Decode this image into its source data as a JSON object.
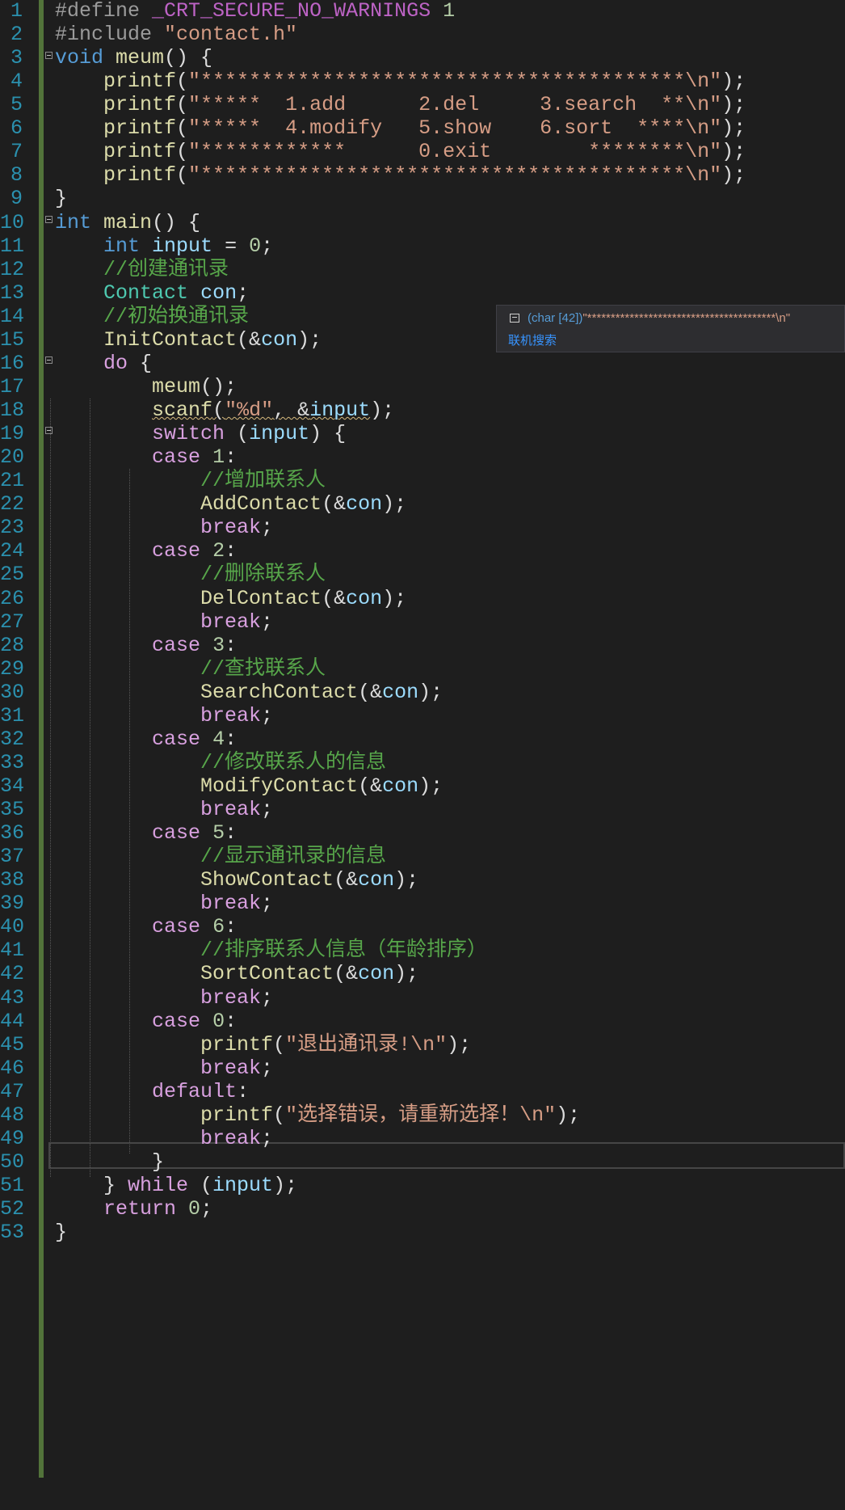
{
  "editor": {
    "line_numbers": [
      "1",
      "2",
      "3",
      "4",
      "5",
      "6",
      "7",
      "8",
      "9",
      "10",
      "11",
      "12",
      "13",
      "14",
      "15",
      "16",
      "17",
      "18",
      "19",
      "20",
      "21",
      "22",
      "23",
      "24",
      "25",
      "26",
      "27",
      "28",
      "29",
      "30",
      "31",
      "32",
      "33",
      "34",
      "35",
      "36",
      "37",
      "38",
      "39",
      "40",
      "41",
      "42",
      "43",
      "44",
      "45",
      "46",
      "47",
      "48",
      "49",
      "50",
      "51",
      "52",
      "53"
    ],
    "lines": [
      [
        {
          "c": "pp",
          "t": "#define "
        },
        {
          "c": "mac",
          "t": "_CRT_SECURE_NO_WARNINGS"
        },
        {
          "c": "pp",
          "t": " "
        },
        {
          "c": "num",
          "t": "1"
        }
      ],
      [
        {
          "c": "pp",
          "t": "#include "
        },
        {
          "c": "str",
          "t": "\"contact.h\""
        }
      ],
      [
        {
          "c": "kw",
          "t": "void"
        },
        {
          "c": "",
          "t": " "
        },
        {
          "c": "fn",
          "t": "meum"
        },
        {
          "c": "",
          "t": "() {"
        }
      ],
      [
        {
          "c": "",
          "t": "    "
        },
        {
          "c": "fn",
          "t": "printf"
        },
        {
          "c": "",
          "t": "("
        },
        {
          "c": "str",
          "t": "\"****************************************\\n\""
        },
        {
          "c": "",
          "t": ");"
        }
      ],
      [
        {
          "c": "",
          "t": "    "
        },
        {
          "c": "fn",
          "t": "printf"
        },
        {
          "c": "",
          "t": "("
        },
        {
          "c": "str",
          "t": "\"*****  1.add      2.del     3.search  **\\n\""
        },
        {
          "c": "",
          "t": ");"
        }
      ],
      [
        {
          "c": "",
          "t": "    "
        },
        {
          "c": "fn",
          "t": "printf"
        },
        {
          "c": "",
          "t": "("
        },
        {
          "c": "str",
          "t": "\"*****  4.modify   5.show    6.sort  ****\\n\""
        },
        {
          "c": "",
          "t": ");"
        }
      ],
      [
        {
          "c": "",
          "t": "    "
        },
        {
          "c": "fn",
          "t": "printf"
        },
        {
          "c": "",
          "t": "("
        },
        {
          "c": "str",
          "t": "\"************      0.exit        ********\\n\""
        },
        {
          "c": "",
          "t": ");"
        }
      ],
      [
        {
          "c": "",
          "t": "    "
        },
        {
          "c": "fn",
          "t": "printf"
        },
        {
          "c": "",
          "t": "("
        },
        {
          "c": "str",
          "t": "\"****************************************\\n\""
        },
        {
          "c": "",
          "t": ");"
        }
      ],
      [
        {
          "c": "",
          "t": "}"
        }
      ],
      [
        {
          "c": "kw",
          "t": "int"
        },
        {
          "c": "",
          "t": " "
        },
        {
          "c": "fn",
          "t": "main"
        },
        {
          "c": "",
          "t": "() {"
        }
      ],
      [
        {
          "c": "",
          "t": "    "
        },
        {
          "c": "kw",
          "t": "int"
        },
        {
          "c": "",
          "t": " "
        },
        {
          "c": "var",
          "t": "input"
        },
        {
          "c": "",
          "t": " = "
        },
        {
          "c": "num",
          "t": "0"
        },
        {
          "c": "",
          "t": ";"
        }
      ],
      [
        {
          "c": "",
          "t": "    "
        },
        {
          "c": "cm",
          "t": "//创建通讯录"
        }
      ],
      [
        {
          "c": "",
          "t": "    "
        },
        {
          "c": "ty",
          "t": "Contact"
        },
        {
          "c": "",
          "t": " "
        },
        {
          "c": "var",
          "t": "con"
        },
        {
          "c": "",
          "t": ";"
        }
      ],
      [
        {
          "c": "",
          "t": "    "
        },
        {
          "c": "cm",
          "t": "//初始换通讯录"
        }
      ],
      [
        {
          "c": "",
          "t": "    "
        },
        {
          "c": "fn",
          "t": "InitContact"
        },
        {
          "c": "",
          "t": "(&"
        },
        {
          "c": "var",
          "t": "con"
        },
        {
          "c": "",
          "t": ");"
        }
      ],
      [
        {
          "c": "",
          "t": "    "
        },
        {
          "c": "ctl",
          "t": "do"
        },
        {
          "c": "",
          "t": " {"
        }
      ],
      [
        {
          "c": "",
          "t": "        "
        },
        {
          "c": "fn",
          "t": "meum"
        },
        {
          "c": "",
          "t": "();"
        }
      ],
      [
        {
          "c": "",
          "t": "        "
        },
        {
          "c": "fn squig",
          "t": "scanf"
        },
        {
          "c": "squig",
          "t": "("
        },
        {
          "c": "str squig",
          "t": "\"%d\""
        },
        {
          "c": "squig",
          "t": ", &"
        },
        {
          "c": "var squig",
          "t": "input"
        },
        {
          "c": "",
          "t": ");"
        }
      ],
      [
        {
          "c": "",
          "t": "        "
        },
        {
          "c": "ctl",
          "t": "switch"
        },
        {
          "c": "",
          "t": " ("
        },
        {
          "c": "var",
          "t": "input"
        },
        {
          "c": "",
          "t": ") {"
        }
      ],
      [
        {
          "c": "",
          "t": "        "
        },
        {
          "c": "ctl",
          "t": "case"
        },
        {
          "c": "",
          "t": " "
        },
        {
          "c": "num",
          "t": "1"
        },
        {
          "c": "",
          "t": ":"
        }
      ],
      [
        {
          "c": "",
          "t": "            "
        },
        {
          "c": "cm",
          "t": "//增加联系人"
        }
      ],
      [
        {
          "c": "",
          "t": "            "
        },
        {
          "c": "fn",
          "t": "AddContact"
        },
        {
          "c": "",
          "t": "(&"
        },
        {
          "c": "var",
          "t": "con"
        },
        {
          "c": "",
          "t": ");"
        }
      ],
      [
        {
          "c": "",
          "t": "            "
        },
        {
          "c": "ctl",
          "t": "break"
        },
        {
          "c": "",
          "t": ";"
        }
      ],
      [
        {
          "c": "",
          "t": "        "
        },
        {
          "c": "ctl",
          "t": "case"
        },
        {
          "c": "",
          "t": " "
        },
        {
          "c": "num",
          "t": "2"
        },
        {
          "c": "",
          "t": ":"
        }
      ],
      [
        {
          "c": "",
          "t": "            "
        },
        {
          "c": "cm",
          "t": "//删除联系人"
        }
      ],
      [
        {
          "c": "",
          "t": "            "
        },
        {
          "c": "fn",
          "t": "DelContact"
        },
        {
          "c": "",
          "t": "(&"
        },
        {
          "c": "var",
          "t": "con"
        },
        {
          "c": "",
          "t": ");"
        }
      ],
      [
        {
          "c": "",
          "t": "            "
        },
        {
          "c": "ctl",
          "t": "break"
        },
        {
          "c": "",
          "t": ";"
        }
      ],
      [
        {
          "c": "",
          "t": "        "
        },
        {
          "c": "ctl",
          "t": "case"
        },
        {
          "c": "",
          "t": " "
        },
        {
          "c": "num",
          "t": "3"
        },
        {
          "c": "",
          "t": ":"
        }
      ],
      [
        {
          "c": "",
          "t": "            "
        },
        {
          "c": "cm",
          "t": "//查找联系人"
        }
      ],
      [
        {
          "c": "",
          "t": "            "
        },
        {
          "c": "fn",
          "t": "SearchContact"
        },
        {
          "c": "",
          "t": "(&"
        },
        {
          "c": "var",
          "t": "con"
        },
        {
          "c": "",
          "t": ");"
        }
      ],
      [
        {
          "c": "",
          "t": "            "
        },
        {
          "c": "ctl",
          "t": "break"
        },
        {
          "c": "",
          "t": ";"
        }
      ],
      [
        {
          "c": "",
          "t": "        "
        },
        {
          "c": "ctl",
          "t": "case"
        },
        {
          "c": "",
          "t": " "
        },
        {
          "c": "num",
          "t": "4"
        },
        {
          "c": "",
          "t": ":"
        }
      ],
      [
        {
          "c": "",
          "t": "            "
        },
        {
          "c": "cm",
          "t": "//修改联系人的信息"
        }
      ],
      [
        {
          "c": "",
          "t": "            "
        },
        {
          "c": "fn",
          "t": "ModifyContact"
        },
        {
          "c": "",
          "t": "(&"
        },
        {
          "c": "var",
          "t": "con"
        },
        {
          "c": "",
          "t": ");"
        }
      ],
      [
        {
          "c": "",
          "t": "            "
        },
        {
          "c": "ctl",
          "t": "break"
        },
        {
          "c": "",
          "t": ";"
        }
      ],
      [
        {
          "c": "",
          "t": "        "
        },
        {
          "c": "ctl",
          "t": "case"
        },
        {
          "c": "",
          "t": " "
        },
        {
          "c": "num",
          "t": "5"
        },
        {
          "c": "",
          "t": ":"
        }
      ],
      [
        {
          "c": "",
          "t": "            "
        },
        {
          "c": "cm",
          "t": "//显示通讯录的信息"
        }
      ],
      [
        {
          "c": "",
          "t": "            "
        },
        {
          "c": "fn",
          "t": "ShowContact"
        },
        {
          "c": "",
          "t": "(&"
        },
        {
          "c": "var",
          "t": "con"
        },
        {
          "c": "",
          "t": ");"
        }
      ],
      [
        {
          "c": "",
          "t": "            "
        },
        {
          "c": "ctl",
          "t": "break"
        },
        {
          "c": "",
          "t": ";"
        }
      ],
      [
        {
          "c": "",
          "t": "        "
        },
        {
          "c": "ctl",
          "t": "case"
        },
        {
          "c": "",
          "t": " "
        },
        {
          "c": "num",
          "t": "6"
        },
        {
          "c": "",
          "t": ":"
        }
      ],
      [
        {
          "c": "",
          "t": "            "
        },
        {
          "c": "cm",
          "t": "//排序联系人信息（年龄排序）"
        }
      ],
      [
        {
          "c": "",
          "t": "            "
        },
        {
          "c": "fn",
          "t": "SortContact"
        },
        {
          "c": "",
          "t": "(&"
        },
        {
          "c": "var",
          "t": "con"
        },
        {
          "c": "",
          "t": ");"
        }
      ],
      [
        {
          "c": "",
          "t": "            "
        },
        {
          "c": "ctl",
          "t": "break"
        },
        {
          "c": "",
          "t": ";"
        }
      ],
      [
        {
          "c": "",
          "t": "        "
        },
        {
          "c": "ctl",
          "t": "case"
        },
        {
          "c": "",
          "t": " "
        },
        {
          "c": "num",
          "t": "0"
        },
        {
          "c": "",
          "t": ":"
        }
      ],
      [
        {
          "c": "",
          "t": "            "
        },
        {
          "c": "fn",
          "t": "printf"
        },
        {
          "c": "",
          "t": "("
        },
        {
          "c": "str",
          "t": "\"退出通讯录!\\n\""
        },
        {
          "c": "",
          "t": ");"
        }
      ],
      [
        {
          "c": "",
          "t": "            "
        },
        {
          "c": "ctl",
          "t": "break"
        },
        {
          "c": "",
          "t": ";"
        }
      ],
      [
        {
          "c": "",
          "t": "        "
        },
        {
          "c": "ctl",
          "t": "default"
        },
        {
          "c": "",
          "t": ":"
        }
      ],
      [
        {
          "c": "",
          "t": "            "
        },
        {
          "c": "fn",
          "t": "printf"
        },
        {
          "c": "",
          "t": "("
        },
        {
          "c": "str",
          "t": "\"选择错误，请重新选择！\\n\""
        },
        {
          "c": "",
          "t": ");"
        }
      ],
      [
        {
          "c": "",
          "t": "            "
        },
        {
          "c": "ctl",
          "t": "break"
        },
        {
          "c": "",
          "t": ";"
        }
      ],
      [
        {
          "c": "",
          "t": "        }"
        }
      ],
      [
        {
          "c": "",
          "t": "    } "
        },
        {
          "c": "ctl",
          "t": "while"
        },
        {
          "c": "",
          "t": " ("
        },
        {
          "c": "var",
          "t": "input"
        },
        {
          "c": "",
          "t": ");"
        }
      ],
      [
        {
          "c": "",
          "t": "    "
        },
        {
          "c": "ctl",
          "t": "return"
        },
        {
          "c": "",
          "t": " "
        },
        {
          "c": "num",
          "t": "0"
        },
        {
          "c": "",
          "t": ";"
        }
      ],
      [
        {
          "c": "",
          "t": "}"
        }
      ]
    ],
    "current_line": "42"
  },
  "tooltip": {
    "type": "(char [42])",
    "value": "\"****************************************\\n\"",
    "link": "联机搜索",
    "icon": "constant-icon"
  },
  "colors": {
    "background": "#1e1e1e",
    "line_number": "#2b91af",
    "change_bar": "#52733a",
    "keyword": "#569cd6",
    "control": "#d8a0df",
    "function": "#dcdcaa",
    "type": "#4ec9b0",
    "variable": "#9cdcfe",
    "string": "#d69d85",
    "comment": "#57a64a"
  }
}
